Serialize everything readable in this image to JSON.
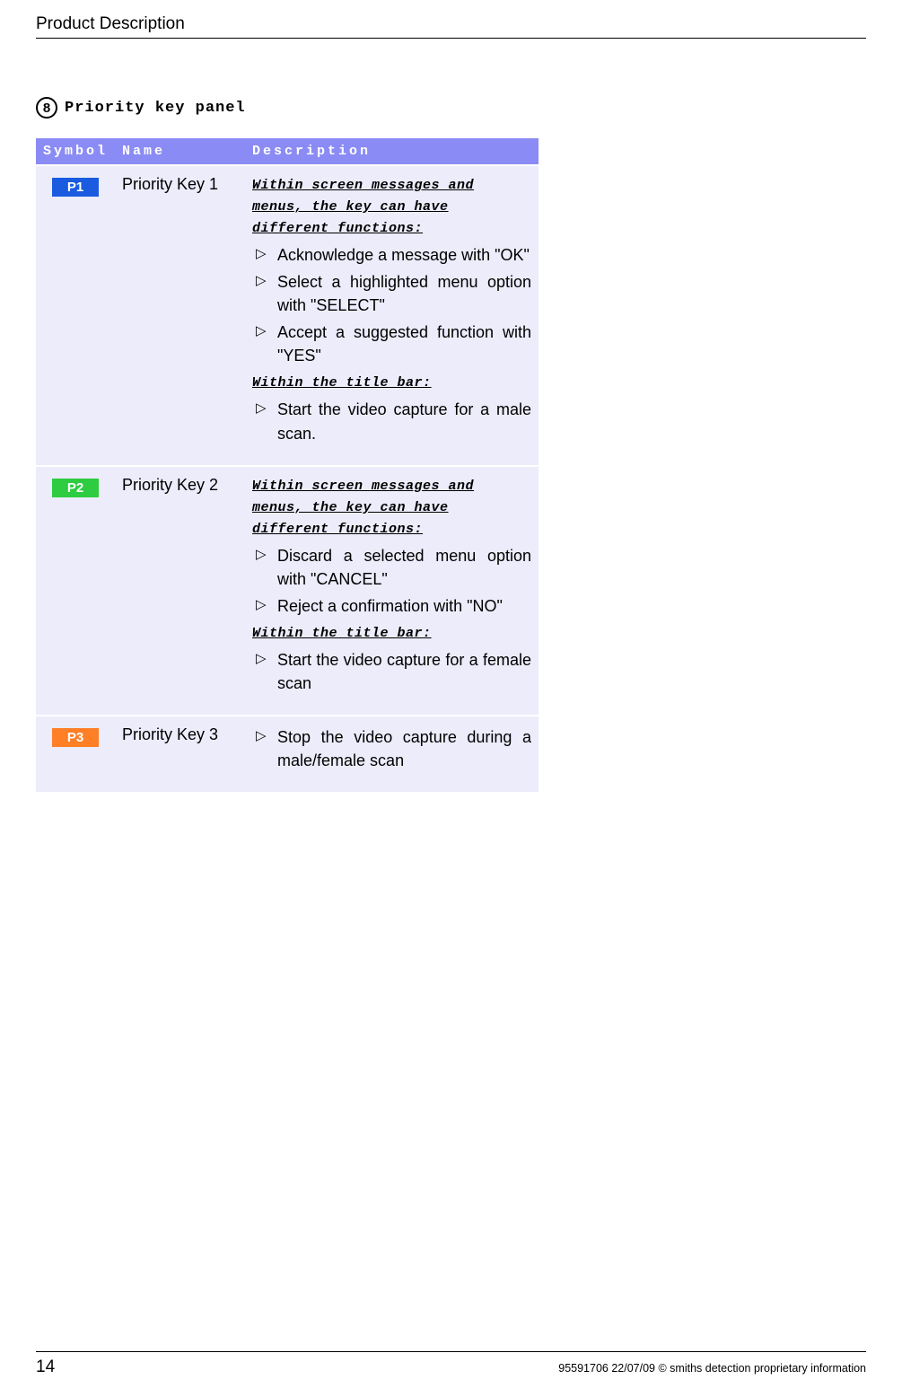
{
  "header": {
    "title": "Product Description"
  },
  "section": {
    "num": "8",
    "title": "Priority key panel"
  },
  "table": {
    "headers": {
      "symbol": "Symbol",
      "name": "Name",
      "description": "Description"
    },
    "rows": [
      {
        "badge": "P1",
        "badgeColor": "#1a5be0",
        "name": "Priority Key 1",
        "blocks": [
          {
            "heading": "Within screen messages and menus, the key can have different functions:",
            "items": [
              "Acknowledge a message with \"OK\"",
              "Select a highlighted menu option with \"SELECT\"",
              "Accept a suggested function with \"YES\""
            ]
          },
          {
            "heading": "Within the title bar:",
            "items": [
              "Start the video capture for a male scan."
            ]
          }
        ]
      },
      {
        "badge": "P2",
        "badgeColor": "#2ecc40",
        "name": "Priority Key 2",
        "blocks": [
          {
            "heading": "Within screen messages and menus, the key can have different functions:",
            "items": [
              "Discard a selected menu option with \"CANCEL\"",
              "Reject a confirmation with \"NO\""
            ]
          },
          {
            "heading": "Within the title bar:",
            "items": [
              "Start the video capture for a female scan"
            ]
          }
        ]
      },
      {
        "badge": "P3",
        "badgeColor": "#ff7f27",
        "name": "Priority Key 3",
        "blocks": [
          {
            "heading": "",
            "items": [
              "Stop the video capture during a male/female scan"
            ]
          }
        ]
      }
    ]
  },
  "footer": {
    "pageNum": "14",
    "right": "95591706 22/07/09 © smiths detection proprietary information"
  }
}
